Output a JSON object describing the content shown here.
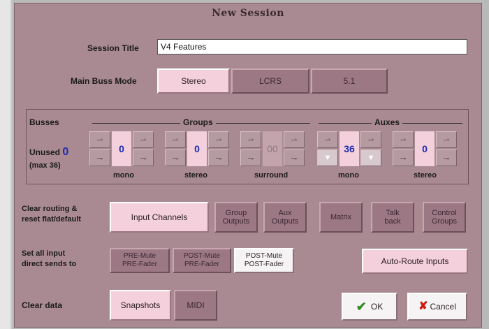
{
  "dialog_title": "New Session",
  "session_title_label": "Session Title",
  "session_title_value": "V4 Features",
  "main_buss_label": "Main Buss Mode",
  "buss_modes": [
    "Stereo",
    "LCRS",
    "5.1"
  ],
  "busses": {
    "label": "Busses",
    "unused_label": "Unused",
    "unused_value": "0",
    "max_label": "(max 36)",
    "groups_label": "Groups",
    "auxes_label": "Auxes",
    "steppers": [
      {
        "value": "0",
        "caption": "mono"
      },
      {
        "value": "0",
        "caption": "stereo"
      },
      {
        "value": "00",
        "caption": "surround"
      },
      {
        "value": "36",
        "caption": "mono"
      },
      {
        "value": "0",
        "caption": "stereo"
      }
    ]
  },
  "clear_routing_label": "Clear routing &\nreset flat/default",
  "clear_routing_buttons": [
    "Input Channels",
    "Group\nOutputs",
    "Aux\nOutputs",
    "Matrix",
    "Talk\nback",
    "Control\nGroups"
  ],
  "direct_sends_label": "Set all input\ndirect sends to",
  "direct_sends_buttons": [
    "PRE-Mute\nPRE-Fader",
    "POST-Mute\nPRE-Fader",
    "POST-Mute\nPOST-Fader"
  ],
  "auto_route_label": "Auto-Route Inputs",
  "clear_data_label": "Clear data",
  "clear_data_buttons": [
    "Snapshots",
    "MIDI"
  ],
  "ok_label": "OK",
  "cancel_label": "Cancel",
  "colors": {
    "panel": "#a98a92",
    "selected": "#f3d0dc",
    "value_text": "#1d2bb0",
    "ok_check": "#2e8b22",
    "cancel_x": "#d01a10"
  }
}
